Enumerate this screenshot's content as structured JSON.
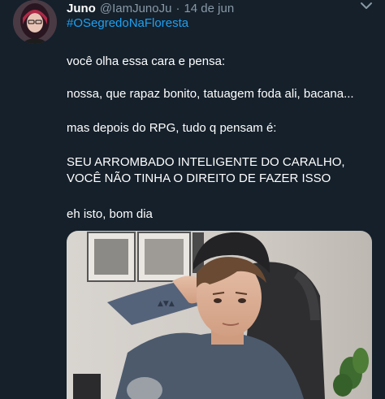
{
  "tweet": {
    "author_name": "Juno",
    "author_handle": "@IamJunoJu",
    "separator": "·",
    "date": "14 de jun",
    "hashtag": "#OSegredoNaFloresta",
    "lines": [
      "você olha essa cara e pensa:",
      "nossa, que rapaz bonito, tatuagem foda ali, bacana...",
      "mas depois do RPG, tudo q pensam é:",
      "SEU ARROMBADO INTELIGENTE DO CARALHO,",
      "VOCÊ NÃO TINHA O DIREITO DE FAZER ISSO",
      "eh isto, bom dia"
    ]
  },
  "icons": {
    "more": "chevron-down-icon",
    "avatar": "avatar"
  },
  "colors": {
    "background": "#15202b",
    "text": "#ffffff",
    "muted": "#8899a6",
    "link": "#1da1f2"
  }
}
